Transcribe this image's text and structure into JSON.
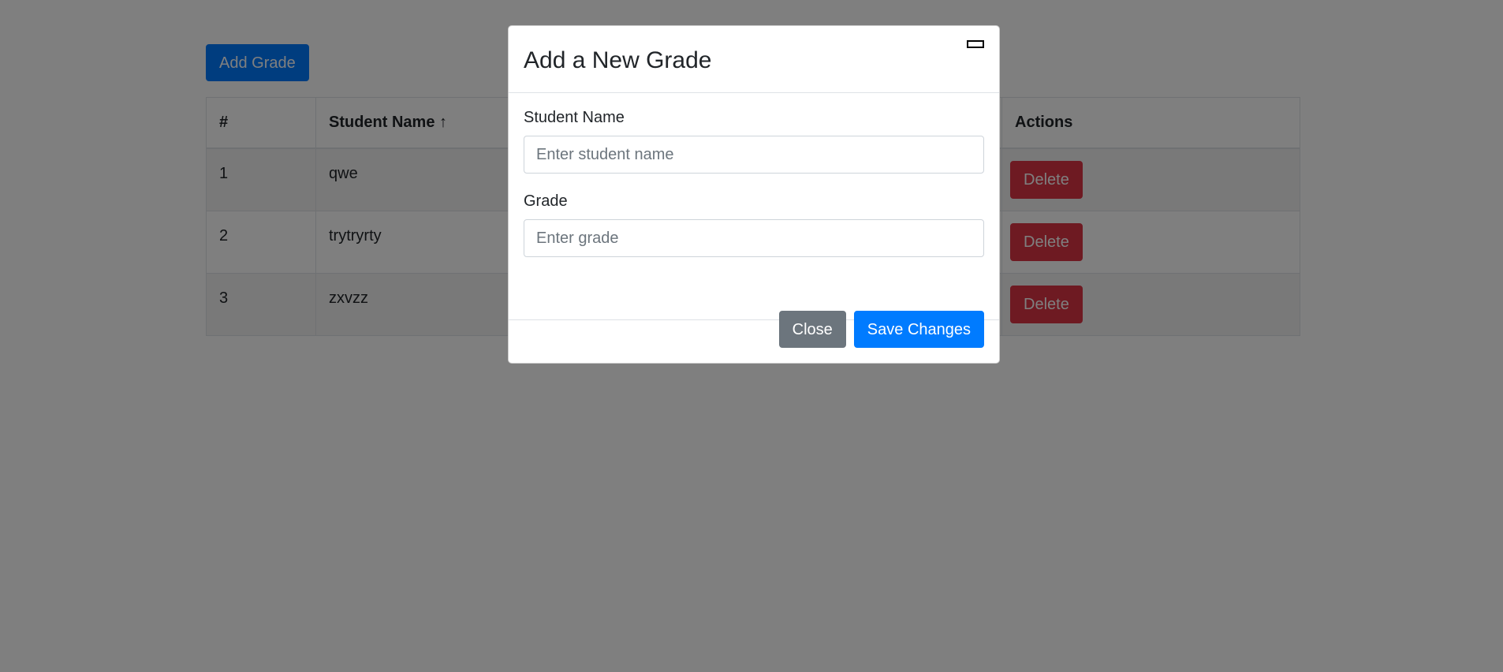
{
  "toolbar": {
    "add_label": "Add Grade"
  },
  "table": {
    "headers": {
      "num": "#",
      "name": "Student Name ↑",
      "actions": "Actions"
    },
    "rows": [
      {
        "num": "1",
        "name": "qwe",
        "action": "Delete"
      },
      {
        "num": "2",
        "name": "trytryrty",
        "action": "Delete"
      },
      {
        "num": "3",
        "name": "zxvzz",
        "action": "Delete"
      }
    ]
  },
  "modal": {
    "title": "Add a New Grade",
    "close_icon": "close-icon",
    "fields": {
      "student_name": {
        "label": "Student Name",
        "placeholder": "Enter student name",
        "value": ""
      },
      "grade": {
        "label": "Grade",
        "placeholder": "Enter grade",
        "value": ""
      }
    },
    "close_label": "Close",
    "save_label": "Save Changes"
  },
  "colors": {
    "primary": "#007bff",
    "danger": "#dc3545",
    "secondary": "#6c757d",
    "backdrop": "rgba(0,0,0,0.5)"
  }
}
